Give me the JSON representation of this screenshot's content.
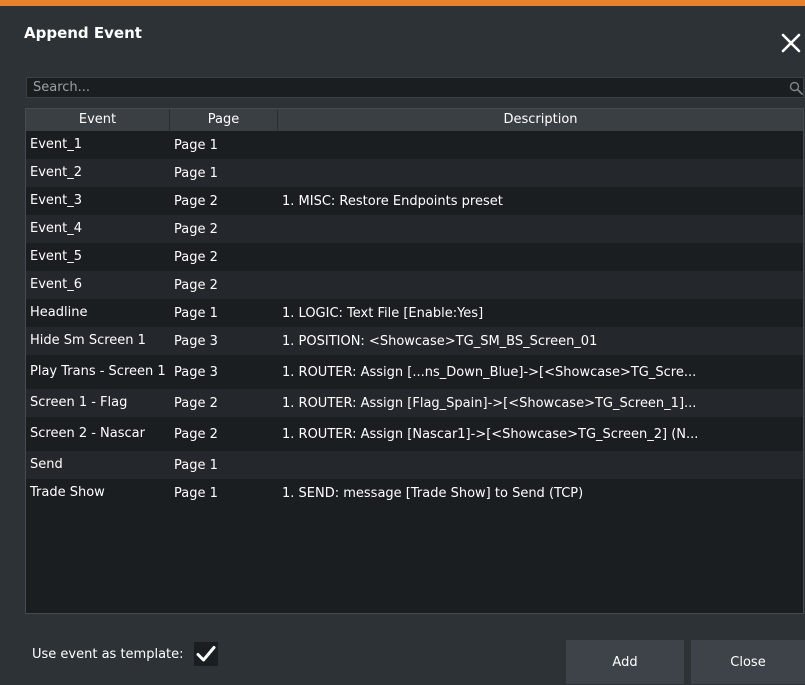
{
  "dialog": {
    "title": "Append Event",
    "accent_color": "#e8812a",
    "close_icon": "close-icon"
  },
  "search": {
    "placeholder": "Search...",
    "value": "",
    "icon": "search-icon"
  },
  "table": {
    "columns": [
      "Event",
      "Page",
      "Description"
    ],
    "rows": [
      {
        "event": "Event_1",
        "page": "Page 1",
        "description": ""
      },
      {
        "event": "Event_2",
        "page": "Page 1",
        "description": ""
      },
      {
        "event": "Event_3",
        "page": "Page 2",
        "description": "1. MISC: Restore Endpoints preset"
      },
      {
        "event": "Event_4",
        "page": "Page 2",
        "description": ""
      },
      {
        "event": "Event_5",
        "page": "Page 2",
        "description": ""
      },
      {
        "event": "Event_6",
        "page": "Page 2",
        "description": ""
      },
      {
        "event": "Headline",
        "page": "Page 1",
        "description": "1. LOGIC: Text File [Enable:Yes]"
      },
      {
        "event": "Hide Sm Screen 1",
        "page": "Page 3",
        "description": "1. POSITION: <Showcase>TG_SM_BS_Screen_01"
      },
      {
        "event": "Play Trans - Screen 1",
        "page": "Page 3",
        "description": "1. ROUTER: Assign [...ns_Down_Blue]->[<Showcase>TG_Scre..."
      },
      {
        "event": "Screen 1 - Flag",
        "page": "Page 2",
        "description": "1. ROUTER: Assign [Flag_Spain]->[<Showcase>TG_Screen_1]..."
      },
      {
        "event": "Screen 2 - Nascar",
        "page": "Page 2",
        "description": "1. ROUTER: Assign [Nascar1]->[<Showcase>TG_Screen_2] (N..."
      },
      {
        "event": "Send",
        "page": "Page 1",
        "description": ""
      },
      {
        "event": "Trade Show",
        "page": "Page 1",
        "description": "1. SEND: message [Trade Show] to Send (TCP)"
      }
    ]
  },
  "footer": {
    "template_label": "Use event as template:",
    "template_checked": true,
    "add_label": "Add",
    "close_label": "Close"
  }
}
